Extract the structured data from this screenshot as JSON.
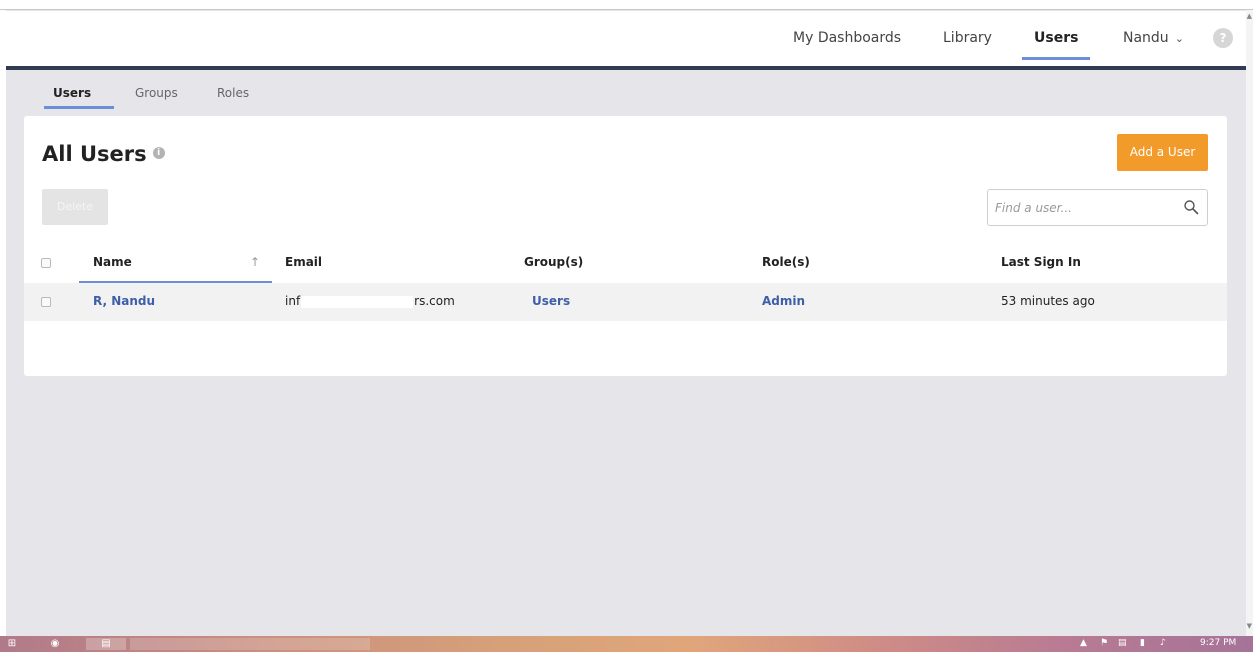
{
  "header": {
    "nav": [
      {
        "label": "My Dashboards",
        "active": false
      },
      {
        "label": "Library",
        "active": false
      },
      {
        "label": "Users",
        "active": true
      }
    ],
    "user_menu_label": "Nandu",
    "help_symbol": "?"
  },
  "subnav": {
    "tabs": [
      {
        "label": "Users",
        "active": true
      },
      {
        "label": "Groups",
        "active": false
      },
      {
        "label": "Roles",
        "active": false
      }
    ]
  },
  "main": {
    "title": "All Users",
    "info_symbol": "i",
    "add_button_label": "Add a User",
    "delete_button_label": "Delete",
    "search_placeholder": "Find a user...",
    "table": {
      "columns": [
        "Name",
        "Email",
        "Group(s)",
        "Role(s)",
        "Last Sign In"
      ],
      "rows": [
        {
          "name": "R, Nandu",
          "email_start": "inf",
          "email_end": "rs.com",
          "groups": "Users",
          "roles": "Admin",
          "last_sign_in": "53 minutes ago"
        }
      ]
    }
  },
  "taskbar": {
    "clock": "9:27 PM"
  },
  "colors": {
    "header_bar": "#2f3b52",
    "accent_underline": "#6a8fd8",
    "add_button": "#f39b2a",
    "link": "#3d5fa6"
  }
}
